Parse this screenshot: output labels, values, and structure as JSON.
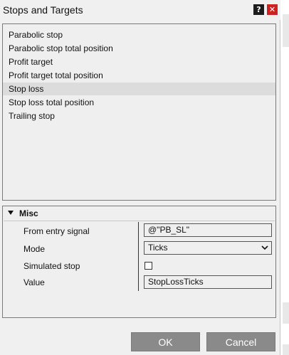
{
  "window": {
    "title": "Stops and Targets",
    "help_label": "?",
    "close_label": "✕"
  },
  "list": {
    "items": [
      {
        "label": "Parabolic stop",
        "selected": false
      },
      {
        "label": "Parabolic stop total position",
        "selected": false
      },
      {
        "label": "Profit target",
        "selected": false
      },
      {
        "label": "Profit target total position",
        "selected": false
      },
      {
        "label": "Stop loss",
        "selected": true
      },
      {
        "label": "Stop loss total position",
        "selected": false
      },
      {
        "label": "Trailing stop",
        "selected": false
      }
    ]
  },
  "properties": {
    "section_title": "Misc",
    "from_entry_signal": {
      "label": "From entry signal",
      "value": "@\"PB_SL\""
    },
    "mode": {
      "label": "Mode",
      "value": "Ticks"
    },
    "simulated_stop": {
      "label": "Simulated stop",
      "checked": false
    },
    "value": {
      "label": "Value",
      "value": "StopLossTicks"
    }
  },
  "buttons": {
    "ok": "OK",
    "cancel": "Cancel"
  },
  "colors": {
    "close_button": "#cc2222",
    "help_button": "#1c1c1c",
    "dialog_button": "#8a8a8a",
    "selected_row": "#dcdcdc"
  }
}
